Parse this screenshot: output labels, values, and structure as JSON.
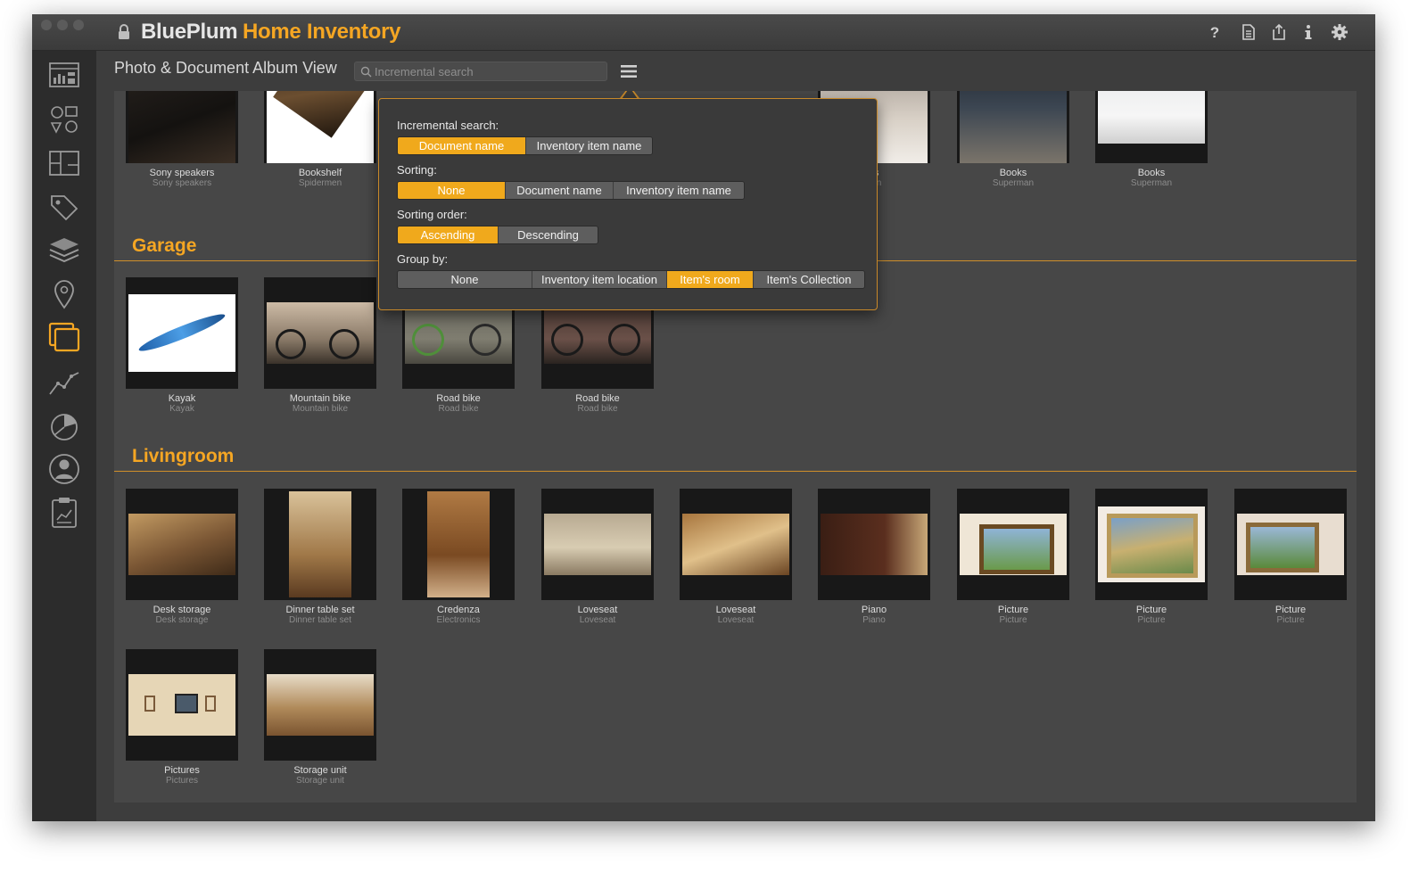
{
  "app": {
    "title": "BluePlum",
    "title_accent": "Home Inventory"
  },
  "colors": {
    "accent": "#f5a623",
    "window_bg": "#3d3d3d",
    "sidebar_bg": "#2c2c2c",
    "content_bg": "#474747"
  },
  "toolbar": {
    "icons": [
      "help-icon",
      "document-icon",
      "share-icon",
      "info-icon",
      "gear-icon"
    ]
  },
  "sidebar": {
    "items": [
      "dashboard-icon",
      "items-icon",
      "rooms-icon",
      "tags-icon",
      "collections-icon",
      "locations-icon",
      "album-view-icon",
      "chart-icon",
      "pie-chart-icon",
      "user-icon",
      "report-icon"
    ],
    "active": "album-view-icon"
  },
  "view": {
    "title": "Photo & Document Album View",
    "search_placeholder": "Incremental search"
  },
  "popover": {
    "incremental_search": {
      "label": "Incremental search:",
      "options": [
        "Document name",
        "Inventory item name"
      ],
      "selected": "Document name"
    },
    "sorting": {
      "label": "Sorting:",
      "options": [
        "None",
        "Document name",
        "Inventory item name"
      ],
      "selected": "None"
    },
    "sorting_order": {
      "label": "Sorting order:",
      "options": [
        "Ascending",
        "Descending"
      ],
      "selected": "Ascending"
    },
    "group_by": {
      "label": "Group by:",
      "options": [
        "None",
        "Inventory item location",
        "Item's room",
        "Item's Collection"
      ],
      "selected": "Item's room"
    }
  },
  "top_group": {
    "items": [
      {
        "name": "Sony speakers",
        "sub": "Sony speakers"
      },
      {
        "name": "Bookshelf",
        "sub": "Spidermen"
      },
      {
        "name": "ks",
        "sub": "nan"
      },
      {
        "name": "Books",
        "sub": "Superman"
      },
      {
        "name": "Books",
        "sub": "Superman"
      }
    ]
  },
  "groups": [
    {
      "title": "Garage",
      "items": [
        {
          "name": "Kayak",
          "sub": "Kayak"
        },
        {
          "name": "Mountain bike",
          "sub": "Mountain bike"
        },
        {
          "name": "Road bike",
          "sub": "Road bike"
        },
        {
          "name": "Road bike",
          "sub": "Road bike"
        }
      ]
    },
    {
      "title": "Livingroom",
      "items": [
        {
          "name": "Desk storage",
          "sub": "Desk storage"
        },
        {
          "name": "Dinner table set",
          "sub": "Dinner table set"
        },
        {
          "name": "Credenza",
          "sub": "Electronics"
        },
        {
          "name": "Loveseat",
          "sub": "Loveseat"
        },
        {
          "name": "Loveseat",
          "sub": "Loveseat"
        },
        {
          "name": "Piano",
          "sub": "Piano"
        },
        {
          "name": "Picture",
          "sub": "Picture"
        },
        {
          "name": "Picture",
          "sub": "Picture"
        },
        {
          "name": "Picture",
          "sub": "Picture"
        },
        {
          "name": "Pictures",
          "sub": "Pictures"
        },
        {
          "name": "Storage unit",
          "sub": "Storage unit"
        }
      ]
    }
  ]
}
